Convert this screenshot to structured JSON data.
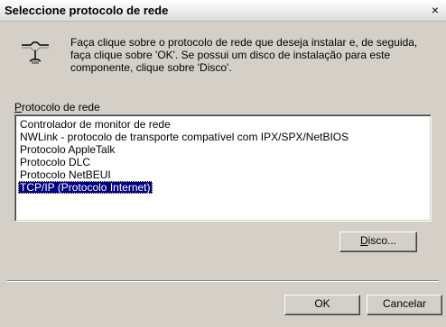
{
  "window": {
    "title": "Seleccione protocolo de rede",
    "close_glyph": "×"
  },
  "instructions": {
    "text": "Faça clique sobre o protocolo de rede que deseja instalar e, de seguida, faça clique sobre 'OK'. Se possui um disco de instalação para este componente, clique sobre 'Disco'."
  },
  "protocol_list": {
    "label_accel": "P",
    "label_rest": "rotocolo de rede",
    "items": [
      {
        "label": "Controlador de monitor de rede"
      },
      {
        "label": "NWLink - protocolo de transporte compatível com IPX/SPX/NetBIOS"
      },
      {
        "label": "Protocolo AppleTalk"
      },
      {
        "label": "Protocolo DLC"
      },
      {
        "label": "Protocolo NetBEUI"
      },
      {
        "label": "TCP/IP (Protocolo Internet)"
      }
    ],
    "selected_index": 5
  },
  "buttons": {
    "disk_accel": "D",
    "disk_rest": "isco...",
    "ok": "OK",
    "cancel": "Cancelar"
  },
  "colors": {
    "dialog_bg": "#d4d0c8",
    "selection_bg": "#000080",
    "selection_text": "#ffffff"
  },
  "icons": {
    "header": "network-protocol-icon",
    "close": "close-icon"
  }
}
